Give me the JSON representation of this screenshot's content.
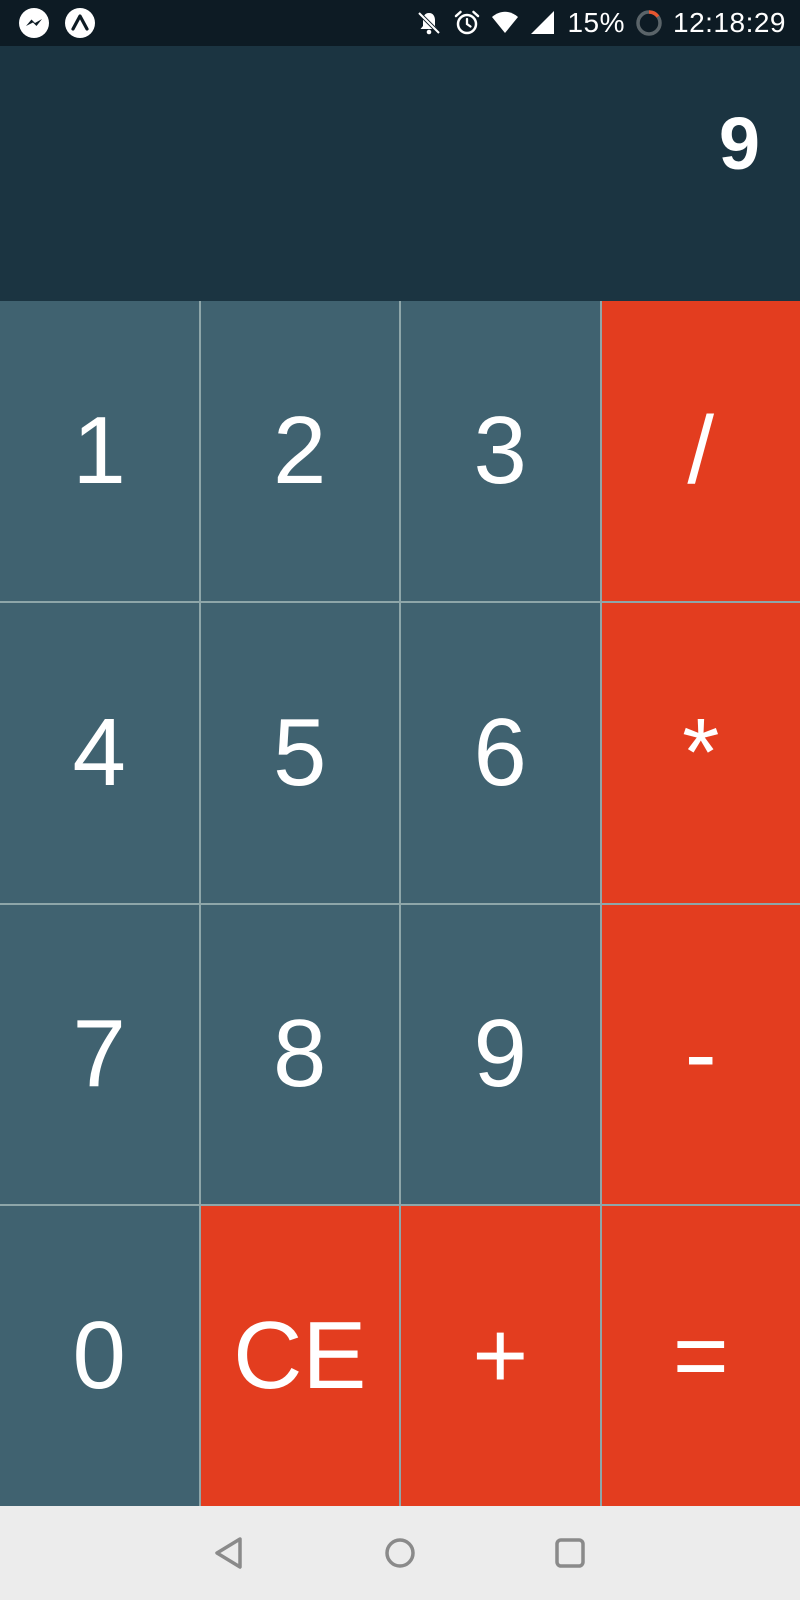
{
  "status_bar": {
    "left_icons": [
      "messenger-icon",
      "expo-icon"
    ],
    "right_icons": [
      "bell-off-icon",
      "alarm-icon",
      "wifi-icon",
      "signal-icon"
    ],
    "battery_percent": "15%",
    "time": "12:18:29"
  },
  "display": {
    "value": "9"
  },
  "keys": [
    {
      "label": "1",
      "type": "number"
    },
    {
      "label": "2",
      "type": "number"
    },
    {
      "label": "3",
      "type": "number"
    },
    {
      "label": "/",
      "type": "operator"
    },
    {
      "label": "4",
      "type": "number"
    },
    {
      "label": "5",
      "type": "number"
    },
    {
      "label": "6",
      "type": "number"
    },
    {
      "label": "*",
      "type": "operator"
    },
    {
      "label": "7",
      "type": "number"
    },
    {
      "label": "8",
      "type": "number"
    },
    {
      "label": "9",
      "type": "number"
    },
    {
      "label": "-",
      "type": "operator"
    },
    {
      "label": "0",
      "type": "number"
    },
    {
      "label": "CE",
      "type": "operator"
    },
    {
      "label": "+",
      "type": "operator"
    },
    {
      "label": "=",
      "type": "operator"
    }
  ],
  "nav_bar": {
    "icons": [
      "back-icon",
      "home-icon",
      "recents-icon"
    ]
  },
  "colors": {
    "status_bar": "#0d1b24",
    "display_background": "#1b3441",
    "number_key": "#406270",
    "operator_key": "#e33d1f",
    "grid_line": "#8ea6a9",
    "nav_bar": "#ececec"
  }
}
